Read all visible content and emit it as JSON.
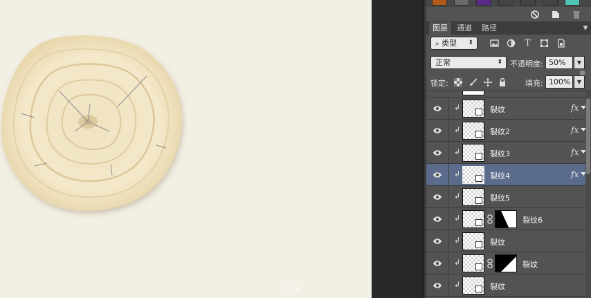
{
  "panel": {
    "tabs": [
      {
        "label": "图层",
        "active": true
      },
      {
        "label": "通道",
        "active": false
      },
      {
        "label": "路径",
        "active": false
      }
    ],
    "filter": {
      "label": "类型"
    },
    "blend": {
      "mode": "正常",
      "opacity_label": "不透明度:",
      "opacity_value": "50%"
    },
    "lock": {
      "label": "锁定:",
      "fill_label": "填充:",
      "fill_value": "100%"
    },
    "layers": [
      {
        "name": "裂纹",
        "fx": "fx",
        "selected": false,
        "has_mask": false
      },
      {
        "name": "裂纹2",
        "fx": "fx",
        "selected": false,
        "has_mask": false
      },
      {
        "name": "裂纹3",
        "fx": "fx",
        "selected": false,
        "has_mask": false
      },
      {
        "name": "裂纹4",
        "fx": "fx",
        "selected": true,
        "has_mask": false
      },
      {
        "name": "裂纹5",
        "fx": "",
        "selected": false,
        "has_mask": false
      },
      {
        "name": "裂纹6",
        "fx": "",
        "selected": false,
        "has_mask": true,
        "mask": "diag-a"
      },
      {
        "name": "裂纹",
        "fx": "",
        "selected": false,
        "has_mask": false
      },
      {
        "name": "裂纹",
        "fx": "",
        "selected": false,
        "has_mask": true,
        "mask": "diag-b"
      },
      {
        "name": "裂纹",
        "fx": "",
        "selected": false,
        "has_mask": false
      }
    ]
  },
  "colors": {
    "canvas_bg": "#f2efe4",
    "wood_light": "#f3e8c9",
    "wood_ring": "#dcc89b",
    "panel_bg": "#535353",
    "selected_layer": "#5a6b8c"
  },
  "icons": {
    "top_tools": [
      "no-entry-icon",
      "new-layer-icon",
      "trash-icon"
    ],
    "filter_icons": [
      "image-filter-icon",
      "adjustment-filter-icon",
      "type-filter-icon",
      "shape-filter-icon",
      "smart-object-filter-icon",
      "filter-toggle-icon"
    ],
    "lock_icons": [
      "lock-transparent-icon",
      "lock-paint-icon",
      "lock-move-icon",
      "lock-all-icon"
    ]
  }
}
